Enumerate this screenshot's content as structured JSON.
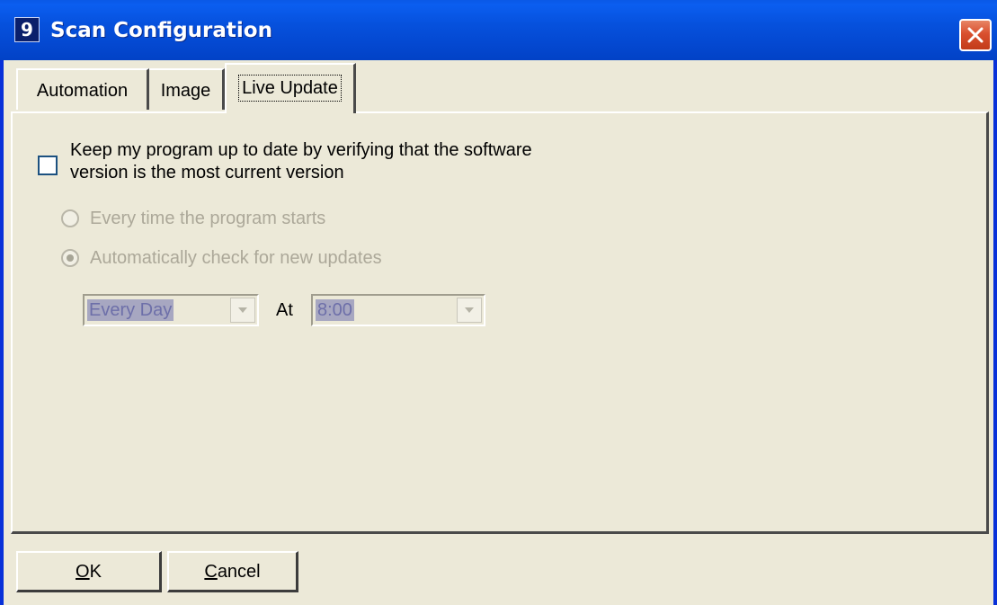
{
  "window": {
    "title": "Scan Configuration",
    "title_icon_glyph": "9",
    "icon": "app-icon",
    "close_icon": "close-icon"
  },
  "tabs": [
    {
      "label": "Automation",
      "selected": false
    },
    {
      "label": "Image",
      "selected": false
    },
    {
      "label": "Live Update",
      "selected": true
    }
  ],
  "live_update": {
    "keep_updated_label": "Keep my program up to date by verifying that the software version is the most current version",
    "keep_updated_checked": false,
    "option_every_start": {
      "label": "Every time the program starts",
      "selected": false,
      "enabled": false
    },
    "option_auto_check": {
      "label": "Automatically check for new updates",
      "selected": true,
      "enabled": false
    },
    "frequency": {
      "value": "Every Day",
      "enabled": false
    },
    "at_label": "At",
    "time": {
      "value": "8:00",
      "enabled": false
    }
  },
  "buttons": {
    "ok": {
      "mnemonic": "O",
      "rest": "K"
    },
    "cancel": {
      "mnemonic": "C",
      "rest": "ancel"
    }
  },
  "colors": {
    "titlebar": "#0651dd",
    "window_bg": "#ece9d8",
    "disabled_text": "#aca899",
    "close_button": "#d9502f"
  }
}
